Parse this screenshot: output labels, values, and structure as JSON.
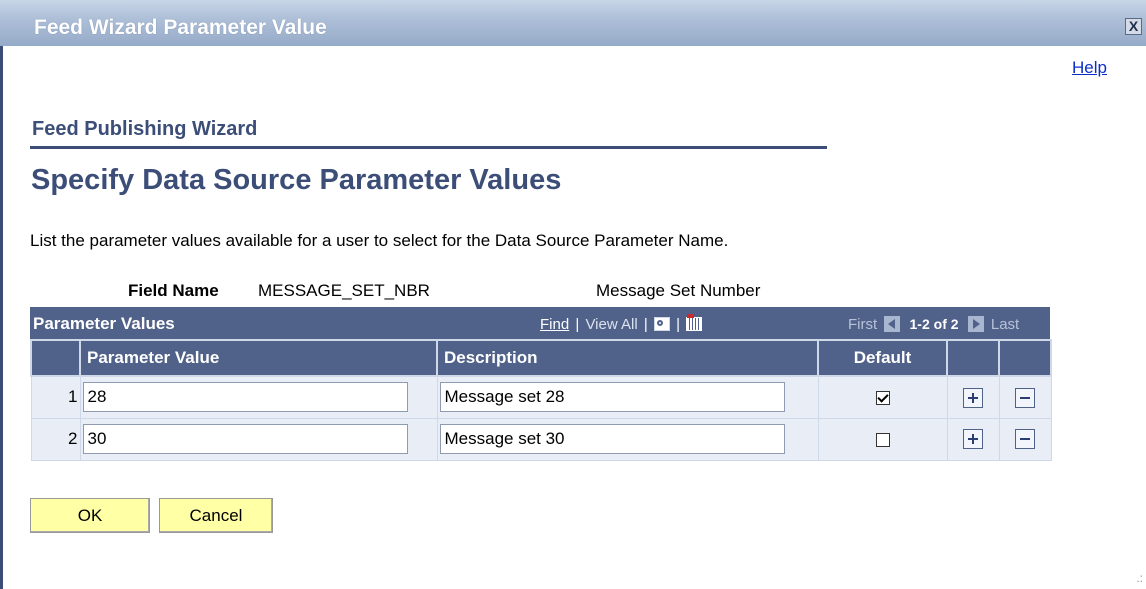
{
  "window": {
    "title": "Feed Wizard Parameter Value",
    "close_label": "X"
  },
  "help_link": "Help",
  "wizard": {
    "title": "Feed Publishing Wizard",
    "page_title": "Specify Data Source Parameter Values",
    "instructions": "List the parameter values available for a user to select for the Data Source Parameter Name."
  },
  "field": {
    "label": "Field Name",
    "value": "MESSAGE_SET_NBR",
    "description": "Message Set Number"
  },
  "grid": {
    "title": "Parameter Values",
    "find_label": "Find",
    "view_all_label": "View All",
    "separator": "|",
    "first_label": "First",
    "count_label": "1-2 of 2",
    "last_label": "Last",
    "columns": {
      "parameter_value": "Parameter Value",
      "description": "Description",
      "default": "Default"
    },
    "rows": [
      {
        "num": "1",
        "parameter_value": "28",
        "description": "Message set 28",
        "default": true
      },
      {
        "num": "2",
        "parameter_value": "30",
        "description": "Message set 30",
        "default": false
      }
    ]
  },
  "buttons": {
    "ok": "OK",
    "cancel": "Cancel"
  },
  "icons": [
    "close-icon",
    "zoom-icon",
    "grid-download-icon",
    "first-arrow-icon",
    "next-arrow-icon",
    "add-row-icon",
    "delete-row-icon"
  ],
  "colors": {
    "accent": "#3c4e78",
    "grid_header": "#51628a",
    "row_bg": "#e9edf5",
    "button_bg": "#ffffa6",
    "link": "#0b2ec8"
  }
}
